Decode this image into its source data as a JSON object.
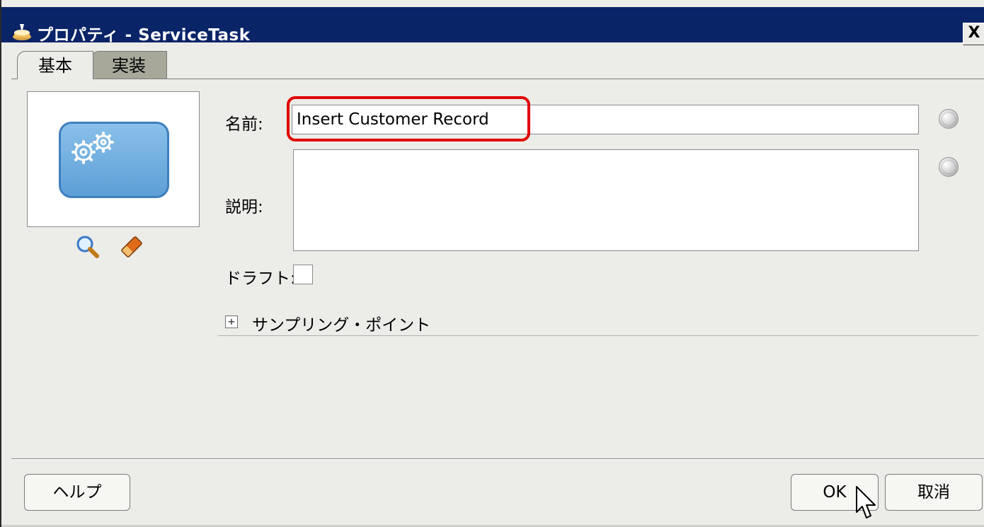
{
  "window": {
    "title": "プロパティ - ServiceTask",
    "close_label": "X"
  },
  "tabs": [
    {
      "label": "基本",
      "active": true
    },
    {
      "label": "実装",
      "active": false
    }
  ],
  "form": {
    "name_label": "名前:",
    "name_value": "Insert Customer Record",
    "description_label": "説明:",
    "description_value": "",
    "draft_label": "ドラフト:",
    "draft_checked": false,
    "sampling_label": "サンプリング・ポイント",
    "sampling_expander": "+"
  },
  "buttons": {
    "help": "ヘルプ",
    "ok": "OK",
    "cancel": "取消"
  },
  "colors": {
    "titlebar": "#0a2468",
    "highlight": "#e00000",
    "task_fill": "#6aaae0"
  },
  "icons": [
    "window-icon",
    "close-icon",
    "gears-icon",
    "search-icon",
    "eraser-icon",
    "globe-icon",
    "expand-icon",
    "cursor-icon"
  ]
}
